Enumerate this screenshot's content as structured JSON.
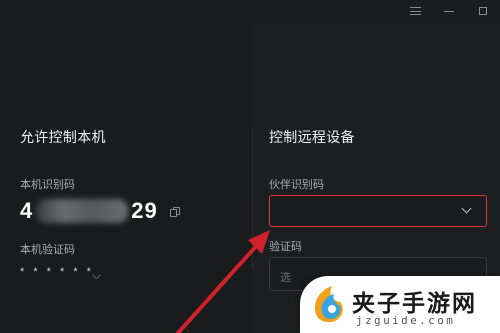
{
  "left": {
    "section_title": "允许控制本机",
    "device_id_label": "本机识别码",
    "device_id_prefix": "4",
    "device_id_suffix": "29",
    "verify_code_label": "本机验证码",
    "verify_code_mask": "* * * * * *"
  },
  "right": {
    "section_title": "控制远程设备",
    "partner_id_label": "伙伴识别码",
    "partner_id_value": "",
    "code_label": "验证码",
    "code_placeholder": "选"
  },
  "watermark": {
    "title": "夹子手游网",
    "url": "jzguide.com"
  },
  "icons": {
    "menu": "menu-icon",
    "minimize": "minimize-icon",
    "maximize": "maximize-icon",
    "copy": "copy-icon",
    "refresh": "refresh-icon",
    "dropdown": "chevron-down-icon"
  },
  "colors": {
    "focus_border": "#d33a3a",
    "arrow": "#d0222b",
    "background": "#1b1c1e"
  }
}
